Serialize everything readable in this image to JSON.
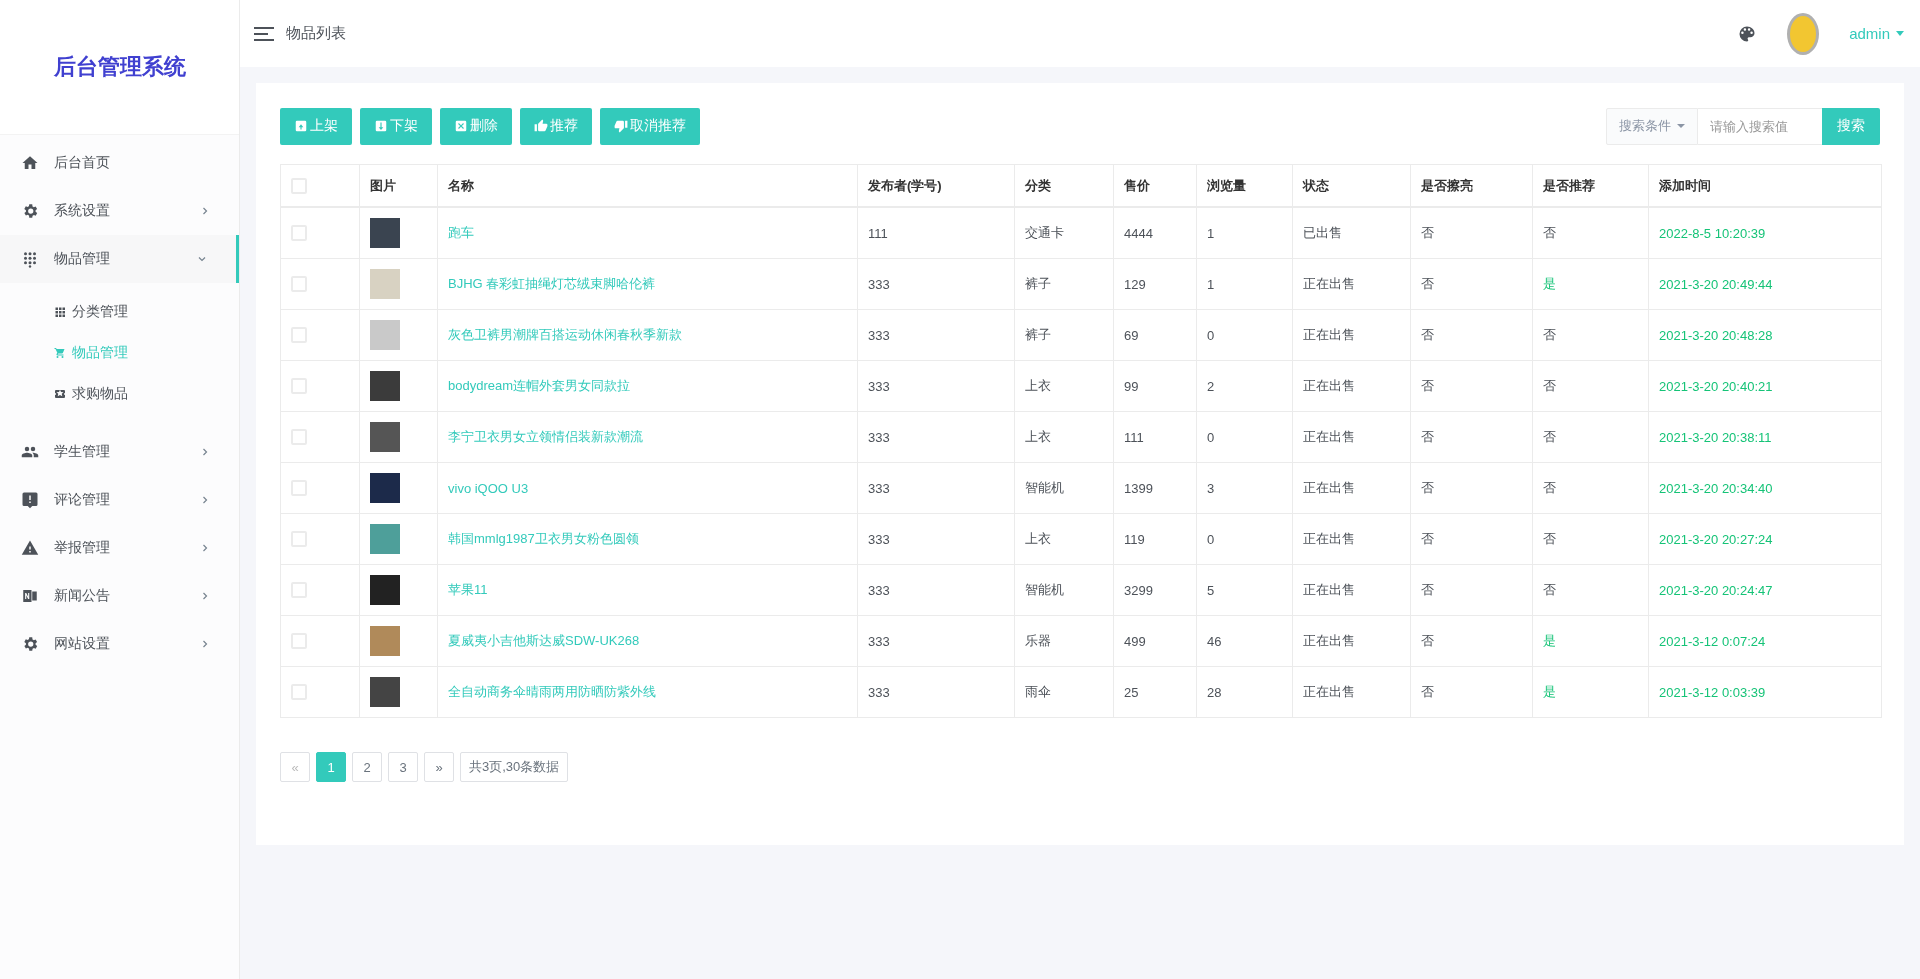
{
  "sidebar": {
    "logo": "后台管理系统",
    "items": [
      {
        "kind": "link",
        "label": "后台首页"
      },
      {
        "kind": "group",
        "label": "系统设置",
        "expanded": false
      },
      {
        "kind": "group",
        "label": "物品管理",
        "expanded": true,
        "children": [
          {
            "label": "分类管理",
            "selected": false
          },
          {
            "label": "物品管理",
            "selected": true
          },
          {
            "label": "求购物品",
            "selected": false
          }
        ]
      },
      {
        "kind": "group",
        "label": "学生管理",
        "expanded": false
      },
      {
        "kind": "group",
        "label": "评论管理",
        "expanded": false
      },
      {
        "kind": "group",
        "label": "举报管理",
        "expanded": false
      },
      {
        "kind": "group",
        "label": "新闻公告",
        "expanded": false
      },
      {
        "kind": "group",
        "label": "网站设置",
        "expanded": false
      }
    ]
  },
  "topbar": {
    "title": "物品列表",
    "user": "admin"
  },
  "toolbar": {
    "buttons": [
      "上架",
      "下架",
      "删除",
      "推荐",
      "取消推荐"
    ]
  },
  "search": {
    "condition": "搜索条件",
    "placeholder": "请输入搜索值",
    "button": "搜索"
  },
  "table": {
    "select_all_checked": false,
    "columns": [
      "图片",
      "名称",
      "发布者(学号)",
      "分类",
      "售价",
      "浏览量",
      "状态",
      "是否擦亮",
      "是否推荐",
      "添加时间"
    ],
    "rows": [
      {
        "checked": false,
        "name": "跑车",
        "publisher": "111",
        "category": "交通卡",
        "price": "4444",
        "views": "1",
        "status": "已出售",
        "polished": "否",
        "recommended": {
          "text": "否",
          "highlighted": false
        },
        "time": "2022-8-5 10:20:39"
      },
      {
        "checked": false,
        "name": "BJHG 春彩虹抽绳灯芯绒束脚哈伦裤",
        "publisher": "333",
        "category": "裤子",
        "price": "129",
        "views": "1",
        "status": "正在出售",
        "polished": "否",
        "recommended": {
          "text": "是",
          "highlighted": true
        },
        "time": "2021-3-20 20:49:44"
      },
      {
        "checked": false,
        "name": "灰色卫裤男潮牌百搭运动休闲春秋季新款",
        "publisher": "333",
        "category": "裤子",
        "price": "69",
        "views": "0",
        "status": "正在出售",
        "polished": "否",
        "recommended": {
          "text": "否",
          "highlighted": false
        },
        "time": "2021-3-20 20:48:28"
      },
      {
        "checked": false,
        "name": "bodydream连帽外套男女同款拉",
        "publisher": "333",
        "category": "上衣",
        "price": "99",
        "views": "2",
        "status": "正在出售",
        "polished": "否",
        "recommended": {
          "text": "否",
          "highlighted": false
        },
        "time": "2021-3-20 20:40:21"
      },
      {
        "checked": false,
        "name": "李宁卫衣男女立领情侣装新款潮流",
        "publisher": "333",
        "category": "上衣",
        "price": "111",
        "views": "0",
        "status": "正在出售",
        "polished": "否",
        "recommended": {
          "text": "否",
          "highlighted": false
        },
        "time": "2021-3-20 20:38:11"
      },
      {
        "checked": false,
        "name": "vivo iQOO U3",
        "publisher": "333",
        "category": "智能机",
        "price": "1399",
        "views": "3",
        "status": "正在出售",
        "polished": "否",
        "recommended": {
          "text": "否",
          "highlighted": false
        },
        "time": "2021-3-20 20:34:40"
      },
      {
        "checked": false,
        "name": "韩国mmlg1987卫衣男女粉色圆领",
        "publisher": "333",
        "category": "上衣",
        "price": "119",
        "views": "0",
        "status": "正在出售",
        "polished": "否",
        "recommended": {
          "text": "否",
          "highlighted": false
        },
        "time": "2021-3-20 20:27:24"
      },
      {
        "checked": false,
        "name": "苹果11",
        "publisher": "333",
        "category": "智能机",
        "price": "3299",
        "views": "5",
        "status": "正在出售",
        "polished": "否",
        "recommended": {
          "text": "否",
          "highlighted": false
        },
        "time": "2021-3-20 20:24:47"
      },
      {
        "checked": false,
        "name": "夏威夷小吉他斯达威SDW-UK268",
        "publisher": "333",
        "category": "乐器",
        "price": "499",
        "views": "46",
        "status": "正在出售",
        "polished": "否",
        "recommended": {
          "text": "是",
          "highlighted": true
        },
        "time": "2021-3-12 0:07:24"
      },
      {
        "checked": false,
        "name": "全自动商务伞晴雨两用防晒防紫外线",
        "publisher": "333",
        "category": "雨伞",
        "price": "25",
        "views": "28",
        "status": "正在出售",
        "polished": "否",
        "recommended": {
          "text": "是",
          "highlighted": true
        },
        "time": "2021-3-12 0:03:39"
      }
    ]
  },
  "pagination": {
    "pages": [
      {
        "label": "«",
        "selected": false,
        "disabled": true
      },
      {
        "label": "1",
        "selected": true,
        "disabled": false
      },
      {
        "label": "2",
        "selected": false,
        "disabled": false
      },
      {
        "label": "3",
        "selected": false,
        "disabled": false
      },
      {
        "label": "»",
        "selected": false,
        "disabled": false
      }
    ],
    "summary": "共3页,30条数据"
  }
}
